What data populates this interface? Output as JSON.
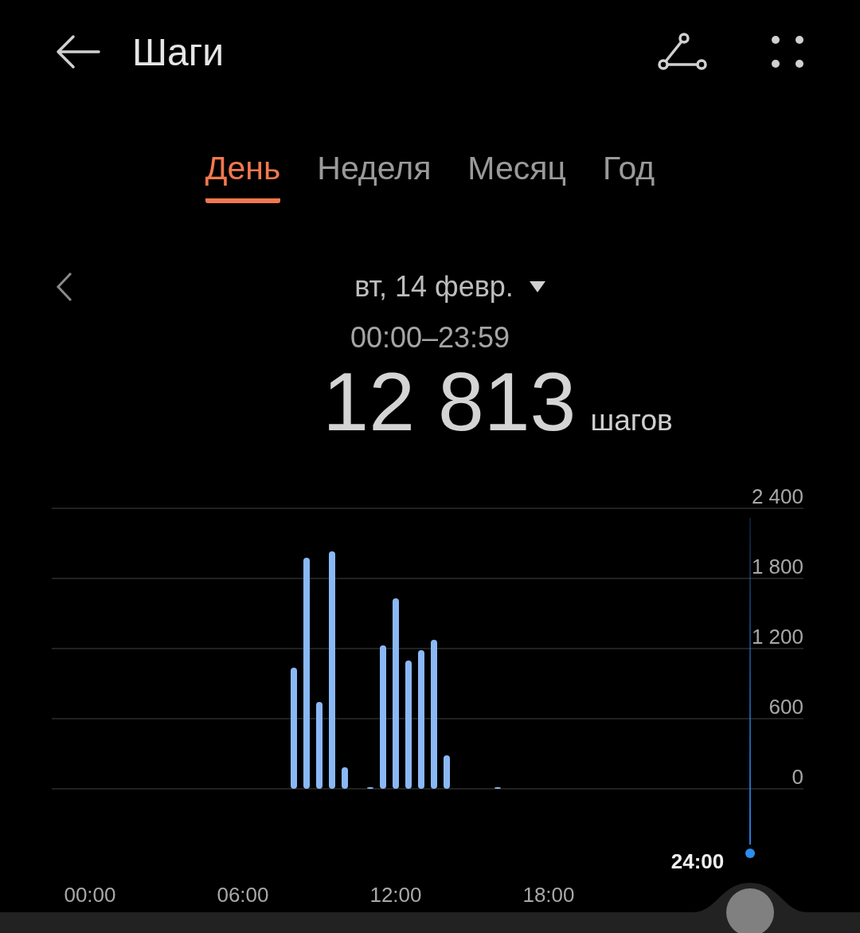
{
  "header": {
    "title": "Шаги"
  },
  "tabs": [
    {
      "label": "День",
      "selected": true
    },
    {
      "label": "Неделя",
      "selected": false
    },
    {
      "label": "Месяц",
      "selected": false
    },
    {
      "label": "Год",
      "selected": false
    }
  ],
  "date": "вт, 14 февр.",
  "time_range": "00:00–23:59",
  "total": {
    "value": "12 813",
    "unit": "шагов"
  },
  "chart": {
    "cursor_label": "24:00",
    "chart_data": {
      "type": "bar",
      "grid": true,
      "x": [
        8,
        8.5,
        9,
        9.5,
        10,
        11,
        11.5,
        12,
        12.5,
        13,
        13.5,
        14,
        16
      ],
      "xlim": [
        -1.5,
        28
      ],
      "series": [
        {
          "color": "#8ab8f5",
          "values": [
            1036,
            1977,
            743,
            2032,
            184,
            14,
            1227,
            1630,
            1098,
            1186,
            1275,
            286,
            14
          ]
        }
      ],
      "ylim": [
        0,
        2400
      ],
      "yticks": [
        {
          "value": 0,
          "label": "0"
        },
        {
          "value": 600,
          "label": "600"
        },
        {
          "value": 1200,
          "label": "1 200"
        },
        {
          "value": 1800,
          "label": "1 800"
        },
        {
          "value": 2400,
          "label": "2 400"
        }
      ],
      "xticks": [
        {
          "value": 0,
          "label": "00:00"
        },
        {
          "value": 6,
          "label": "06:00"
        },
        {
          "value": 12,
          "label": "12:00"
        },
        {
          "value": 18,
          "label": "18:00"
        }
      ]
    }
  }
}
